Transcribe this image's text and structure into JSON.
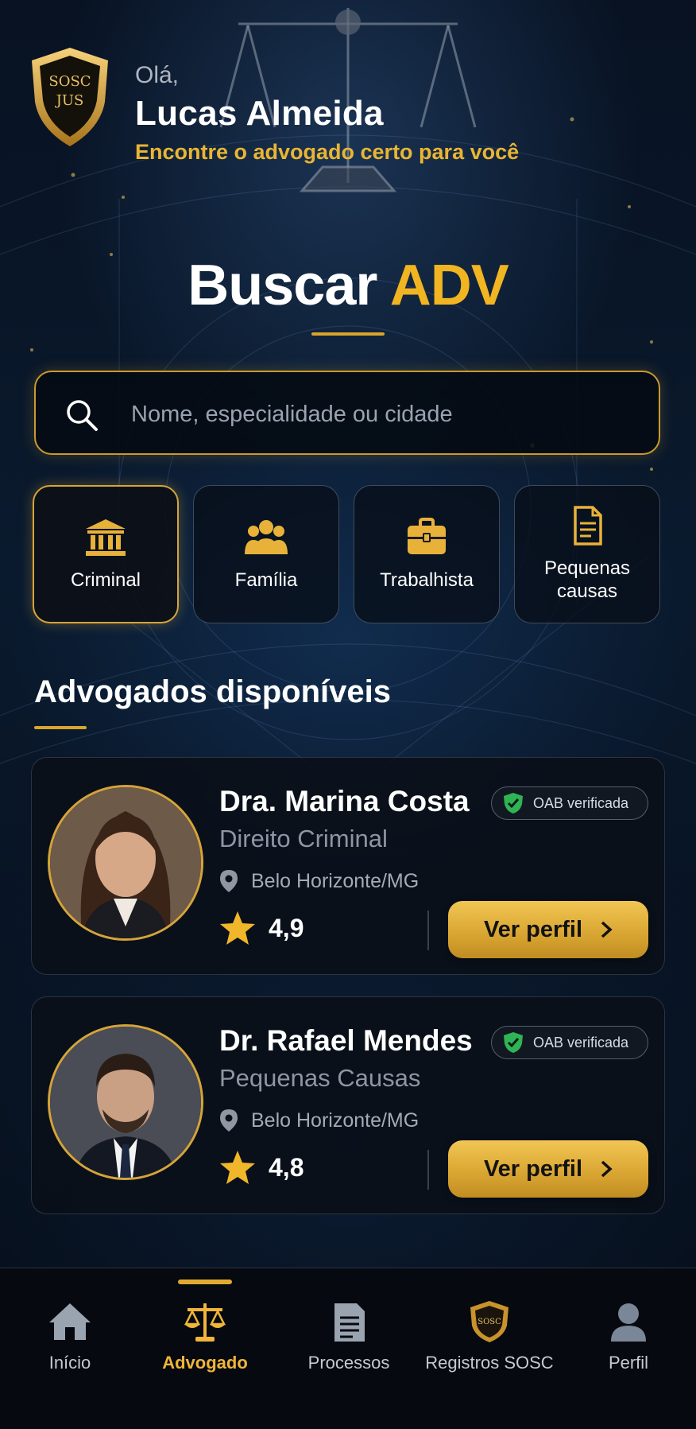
{
  "header": {
    "logo_text": "SOSC JUS",
    "greeting": "Olá,",
    "user_name": "Lucas Almeida",
    "subtitle": "Encontre o advogado certo para você"
  },
  "page": {
    "title_white": "Buscar",
    "title_gold": "ADV"
  },
  "search": {
    "placeholder": "Nome, especialidade ou cidade",
    "icon": "search-icon"
  },
  "categories": [
    {
      "label": "Criminal",
      "icon": "courthouse-icon",
      "active": true
    },
    {
      "label": "Família",
      "icon": "family-icon",
      "active": false
    },
    {
      "label": "Trabalhista",
      "icon": "briefcase-icon",
      "active": false
    },
    {
      "label": "Pequenas causas",
      "icon": "document-icon",
      "active": false
    }
  ],
  "section": {
    "title": "Advogados disponíveis"
  },
  "lawyers": [
    {
      "name": "Dra. Marina Costa",
      "badge": "OAB verificada",
      "specialty": "Direito Criminal",
      "location": "Belo Horizonte/MG",
      "rating": "4,9",
      "button": "Ver perfil"
    },
    {
      "name": "Dr. Rafael Mendes",
      "badge": "OAB verificada",
      "specialty": "Pequenas Causas",
      "location": "Belo Horizonte/MG",
      "rating": "4,8",
      "button": "Ver perfil"
    }
  ],
  "nav": [
    {
      "label": "Início",
      "icon": "home-icon",
      "active": false
    },
    {
      "label": "Advogado",
      "icon": "scales-icon",
      "active": true
    },
    {
      "label": "Processos",
      "icon": "document-list-icon",
      "active": false
    },
    {
      "label": "Registros SOSC",
      "icon": "sosc-shield-icon",
      "active": false
    },
    {
      "label": "Perfil",
      "icon": "user-icon",
      "active": false
    }
  ],
  "colors": {
    "gold": "#e9b533",
    "background": "#06101d",
    "verified_green": "#2fb455"
  }
}
